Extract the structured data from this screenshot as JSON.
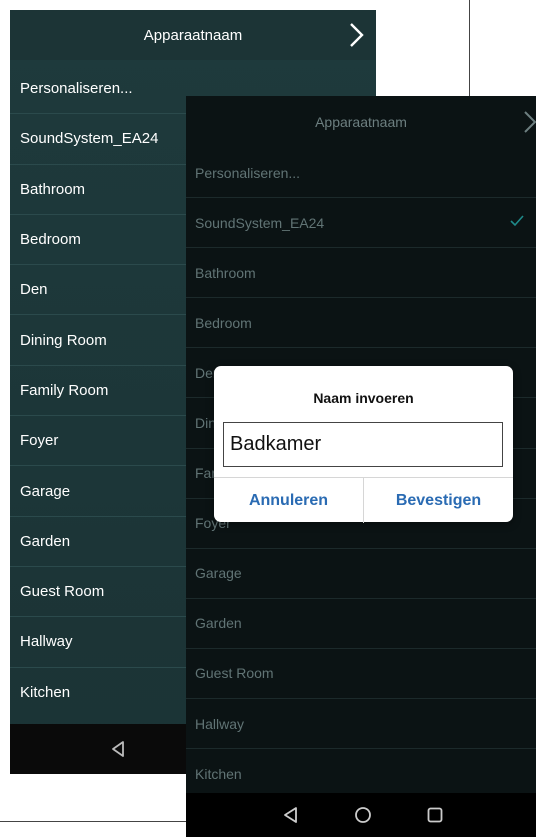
{
  "back_screen": {
    "header_title": "Apparaatnaam",
    "items": [
      "Personaliseren...",
      "SoundSystem_EA24",
      "Bathroom",
      "Bedroom",
      "Den",
      "Dining Room",
      "Family Room",
      "Foyer",
      "Garage",
      "Garden",
      "Guest Room",
      "Hallway",
      "Kitchen"
    ]
  },
  "front_screen": {
    "header_title": "Apparaatnaam",
    "items": [
      "Personaliseren...",
      "SoundSystem_EA24",
      "Bathroom",
      "Bedroom",
      "Den",
      "Dining Room",
      "Family Room",
      "Foyer",
      "Garage",
      "Garden",
      "Guest Room",
      "Hallway",
      "Kitchen"
    ],
    "selected_item": "SoundSystem_EA24"
  },
  "dialog": {
    "title": "Naam invoeren",
    "input_value": "Badkamer",
    "cancel_label": "Annuleren",
    "confirm_label": "Bevestigen"
  },
  "colors": {
    "back_bg": "#1e3a3c",
    "front_bg": "#0b1314",
    "check": "#1f8a8a",
    "button_blue": "#2a6bb3"
  }
}
